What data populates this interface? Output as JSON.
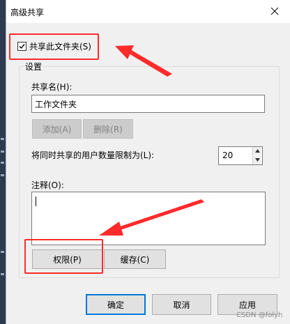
{
  "dialog": {
    "title": "高级共享"
  },
  "share": {
    "checkbox_label": "共享此文件夹(S)",
    "checked": true
  },
  "settings": {
    "group_label": "设置",
    "share_name_label": "共享名(H):",
    "share_name_value": "工作文件夹",
    "add_label": "添加(A)",
    "remove_label": "删除(R)",
    "user_limit_label": "将同时共享的用户数量限制为(L):",
    "user_limit_value": "20",
    "comment_label": "注释(O):",
    "comment_value": "",
    "permissions_label": "权限(P)",
    "caching_label": "缓存(C)"
  },
  "footer": {
    "ok_label": "确定",
    "cancel_label": "取消",
    "apply_label": "应用"
  },
  "watermark": "CSDN @folyh",
  "colors": {
    "highlight": "#ff2b2b",
    "default_button_border": "#0078d7"
  }
}
